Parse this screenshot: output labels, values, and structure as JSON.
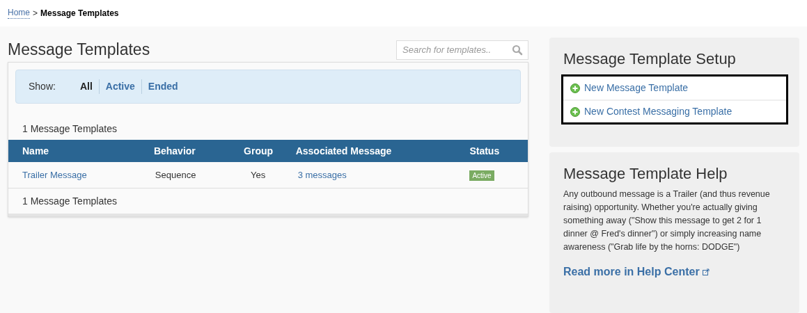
{
  "breadcrumb": {
    "home": "Home",
    "separator": ">",
    "current": "Message Templates"
  },
  "title": "Message Templates",
  "search": {
    "placeholder": "Search for templates.."
  },
  "filter": {
    "label": "Show:",
    "options": [
      {
        "label": "All",
        "selected": true
      },
      {
        "label": "Active",
        "selected": false
      },
      {
        "label": "Ended",
        "selected": false
      }
    ]
  },
  "count_top": "1 Message Templates",
  "table": {
    "columns": [
      "Name",
      "Behavior",
      "Group",
      "Associated Message",
      "Status"
    ],
    "rows": [
      {
        "name": "Trailer Message",
        "behavior": "Sequence",
        "group": "Yes",
        "associated": "3 messages",
        "status": "Active",
        "color": "#7aab62"
      }
    ]
  },
  "count_bottom": "1 Message Templates",
  "setup": {
    "title": "Message Template Setup",
    "links": [
      "New Message Template",
      "New Contest Messaging Template"
    ]
  },
  "help": {
    "title": "Message Template Help",
    "body": "Any outbound message is a Trailer (and thus revenue raising) opportunity. Whether you're actually giving something away (\"Show this message to get 2 for 1 dinner @ Fred's dinner\") or simply increasing name awareness (\"Grab life by the horns: DODGE\")",
    "link": "Read more in Help Center"
  }
}
